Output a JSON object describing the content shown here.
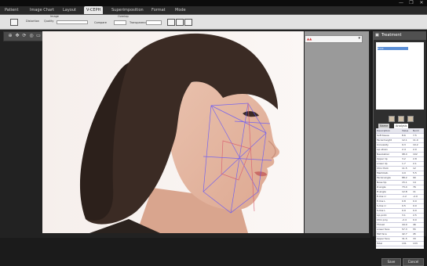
{
  "window": {
    "controls": [
      "—",
      "❐",
      "✕"
    ]
  },
  "menu": [
    {
      "label": "Patient",
      "active": false
    },
    {
      "label": "Image Chart",
      "active": false
    },
    {
      "label": "Layout",
      "active": false
    },
    {
      "label": "V-CEPH",
      "active": true
    },
    {
      "label": "Superimposition",
      "active": false
    },
    {
      "label": "Format",
      "active": false
    },
    {
      "label": "Mode",
      "active": false
    }
  ],
  "ribbon": {
    "group1_label": "Image",
    "group2_label": "Overlap",
    "opt1": "Distortion",
    "opt2": "Quality",
    "opt3": "Compare",
    "opt4": "Transparency",
    "opt5": "Display"
  },
  "panel": {
    "title": "Treatment",
    "list": [
      "",
      "Front"
    ],
    "tabs": [
      "Name",
      "Analysis"
    ],
    "columns": [
      "Description",
      "Value",
      "Norm"
    ],
    "rows": [
      [
        "Soft tissue",
        "8.6",
        "7.5"
      ],
      [
        "Facial height",
        "12.1",
        "11.0"
      ],
      [
        "Convexity",
        "9.3",
        "10.2"
      ],
      [
        "Lip strain",
        "2.4",
        "2.0"
      ],
      [
        "Nasolabial",
        "98.4",
        "102"
      ],
      [
        "Upper lip",
        "3.2",
        "2.8"
      ],
      [
        "Lower lip",
        "1.7",
        "2.1"
      ],
      [
        "Chin thick",
        "11.5",
        "12"
      ],
      [
        "Mentolab.",
        "4.9",
        "5.5"
      ],
      [
        "Facial angle",
        "88.2",
        "90"
      ],
      [
        "Nose tip",
        "15.1",
        "14"
      ],
      [
        "Z-angle",
        "73.4",
        "76"
      ],
      [
        "H-angle",
        "12.8",
        "11"
      ],
      [
        "E-line U",
        "-1.2",
        "-2.0"
      ],
      [
        "E-line L",
        "0.8",
        "0.0"
      ],
      [
        "S-line U",
        "0.5",
        "0.0"
      ],
      [
        "S-line L",
        "0.9",
        "0.0"
      ],
      [
        "Lip protr.",
        "3.1",
        "2.5"
      ],
      [
        "Chin proj.",
        "-2.4",
        "0.0"
      ],
      [
        "Throat",
        "44.0",
        "46"
      ],
      [
        "Lower face",
        "57.3",
        "55"
      ],
      [
        "Mid face",
        "42.7",
        "45"
      ],
      [
        "Upper face",
        "31.5",
        "33"
      ],
      [
        "Total",
        "131",
        "133"
      ]
    ],
    "ok_label": "Save",
    "cancel_label": "Cancel"
  },
  "icons": {
    "zoom": "zoom-icon",
    "move": "move-icon",
    "rotate": "rotate-icon",
    "measure": "measure-icon",
    "undo": "undo-icon",
    "redo": "redo-icon"
  },
  "colors": {
    "accent": "#5b8fd6",
    "trace": "#5b4fff"
  }
}
